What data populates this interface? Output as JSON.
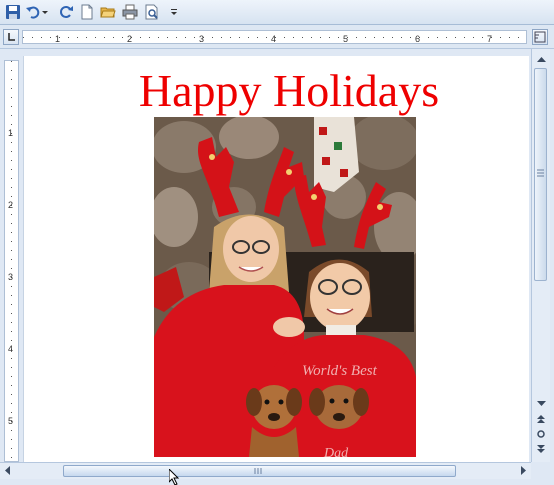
{
  "document": {
    "heading": "Happy Holidays",
    "sweater_text": "World's Best",
    "sweater_text_2": "Dad"
  },
  "ruler": {
    "labels": [
      "1",
      "2",
      "3",
      "4",
      "5",
      "6",
      "7"
    ],
    "vlabels": [
      "1",
      "2",
      "3",
      "4",
      "5"
    ]
  },
  "colors": {
    "heading": "#ee0000",
    "sweater": "#d8121c",
    "chrome": "#dfe8f4"
  },
  "icons": {
    "save": "save-icon",
    "undo": "undo-icon",
    "redo": "redo-icon",
    "new": "new-document-icon",
    "open": "open-folder-icon",
    "print": "print-icon",
    "preview": "print-preview-icon",
    "customize": "customize-qat-icon"
  }
}
